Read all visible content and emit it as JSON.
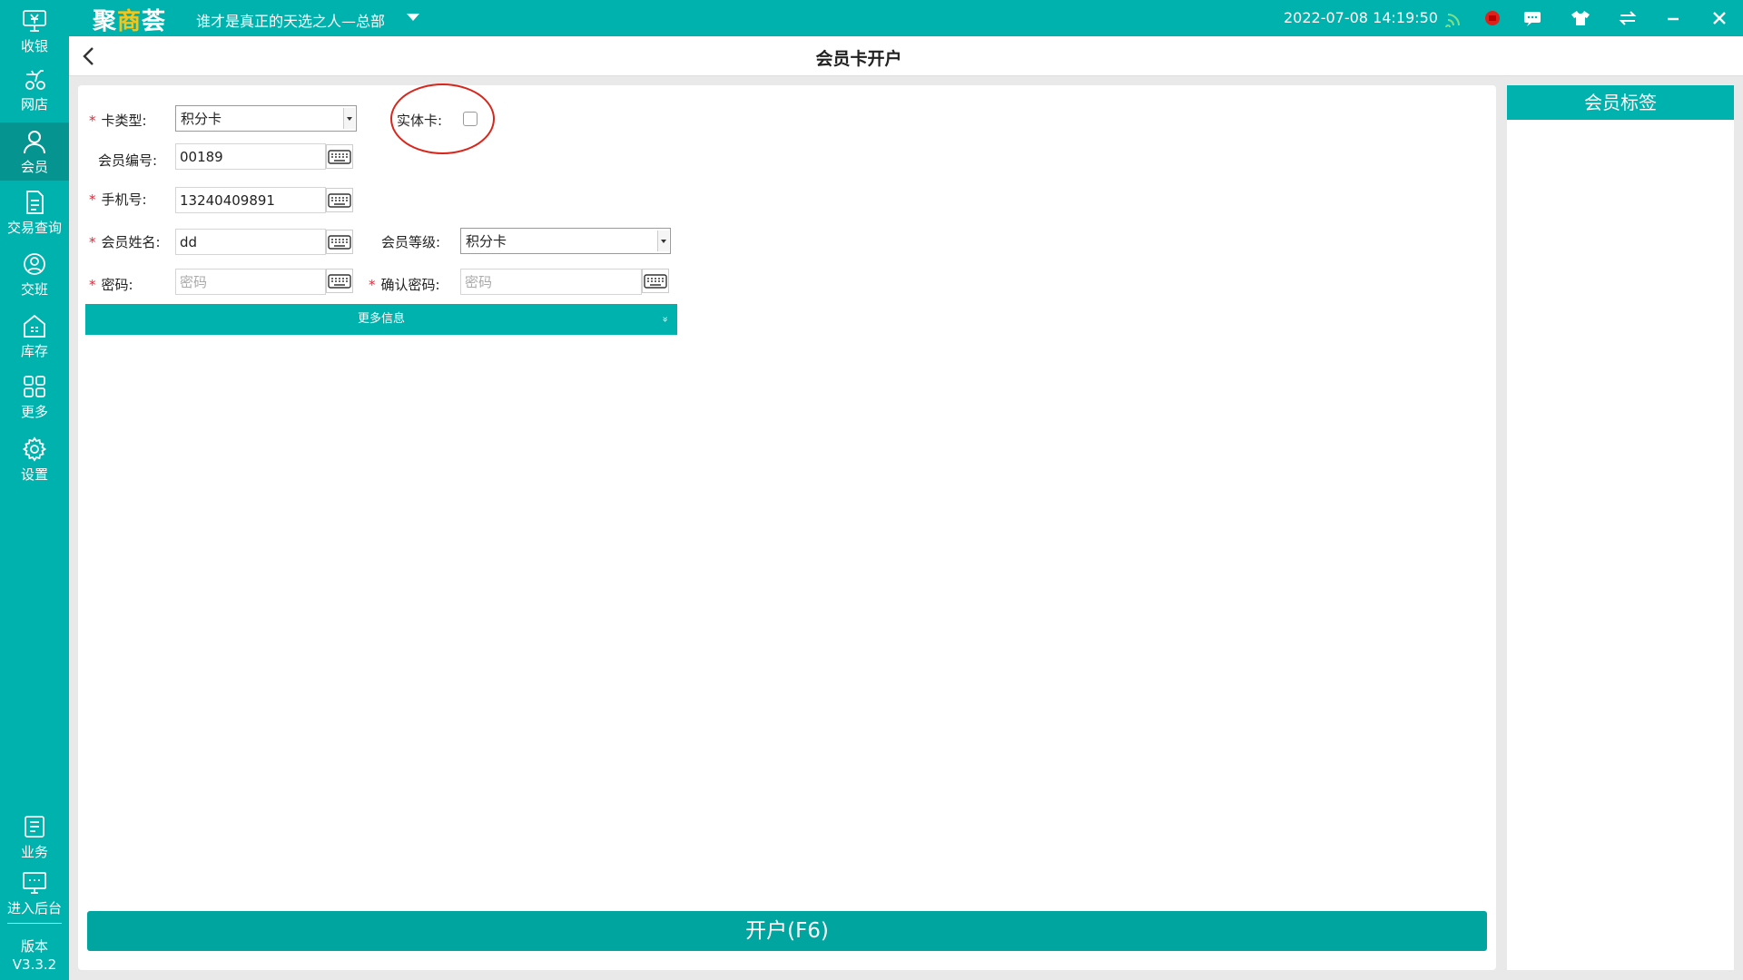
{
  "sidebar": {
    "items": [
      {
        "label": "收银",
        "icon": "cashier-icon"
      },
      {
        "label": "网店",
        "icon": "online-store-icon"
      },
      {
        "label": "会员",
        "icon": "member-icon",
        "active": true
      },
      {
        "label": "交易查询",
        "icon": "transaction-query-icon"
      },
      {
        "label": "交班",
        "icon": "shift-handover-icon"
      },
      {
        "label": "库存",
        "icon": "inventory-icon"
      },
      {
        "label": "更多",
        "icon": "more-grid-icon"
      },
      {
        "label": "设置",
        "icon": "settings-gear-icon"
      }
    ],
    "bottom": [
      {
        "label": "业务",
        "icon": "business-icon"
      },
      {
        "label": "进入后台",
        "icon": "backend-monitor-icon"
      }
    ],
    "version_label": "版本",
    "version": "V3.3.2"
  },
  "topbar": {
    "logo_pre": "聚",
    "logo_hl": "商",
    "logo_post": "荟",
    "store_name": "谁才是真正的天选之人—总部",
    "datetime": "2022-07-08 14:19:50",
    "icons": [
      "wifi-signal-icon",
      "record-status-icon",
      "message-icon",
      "theme-shirt-icon",
      "switch-arrows-icon",
      "minimize-icon",
      "close-icon"
    ]
  },
  "page": {
    "title": "会员卡开户"
  },
  "form": {
    "card_type": {
      "label": "卡类型:",
      "value": "积分卡"
    },
    "physical_card": {
      "label": "实体卡:",
      "checked": false
    },
    "member_no": {
      "label": "会员编号:",
      "value": "00189"
    },
    "phone": {
      "label": "手机号:",
      "value": "13240409891"
    },
    "member_name": {
      "label": "会员姓名:",
      "value": "dd"
    },
    "member_level": {
      "label": "会员等级:",
      "value": "积分卡"
    },
    "password": {
      "label": "密码:",
      "placeholder": "密码"
    },
    "confirm_password": {
      "label": "确认密码:",
      "placeholder": "密码"
    },
    "more_info": "更多信息",
    "submit": "开户(F6)"
  },
  "right_panel": {
    "title": "会员标签"
  },
  "colors": {
    "brand": "#00b2ad",
    "accent": "#f5c518",
    "required": "#e22233",
    "annotation": "#d9261c"
  }
}
